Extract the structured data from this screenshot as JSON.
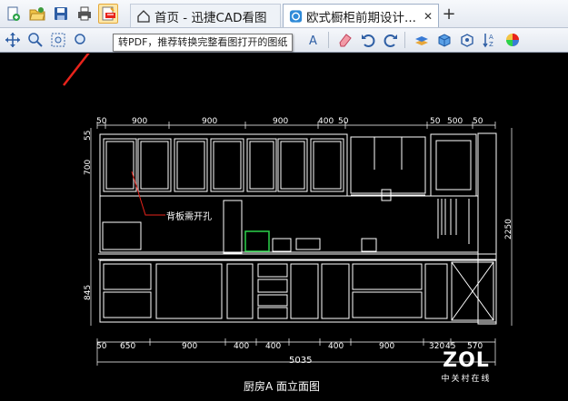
{
  "tabs": {
    "home_label": "首页 - 迅捷CAD看图",
    "doc_label": "欧式橱柜前期设计...",
    "doc_close": "✕",
    "new_tab": "+"
  },
  "tooltip": "转PDF，推荐转换完整看图打开的图纸",
  "drawing": {
    "title": "厨房A 面立面图",
    "note": "背板需开孔",
    "total_width": "5035",
    "top_dims": [
      "50",
      "900",
      "900",
      "900",
      "400",
      "50",
      "50",
      "500",
      "50"
    ],
    "bottom_dims": [
      "50",
      "650",
      "900",
      "400",
      "400",
      "400",
      "900",
      "320",
      "45",
      "570"
    ],
    "left_dims": [
      "55",
      "700",
      "845"
    ],
    "right_dim": "2250"
  },
  "watermark": {
    "logo": "ZOL",
    "sub": "中关村在线"
  },
  "colors": {
    "accent_red": "#e8231b",
    "cad_green": "#2bd34a",
    "toolbar_bg": "#e9edf3"
  }
}
